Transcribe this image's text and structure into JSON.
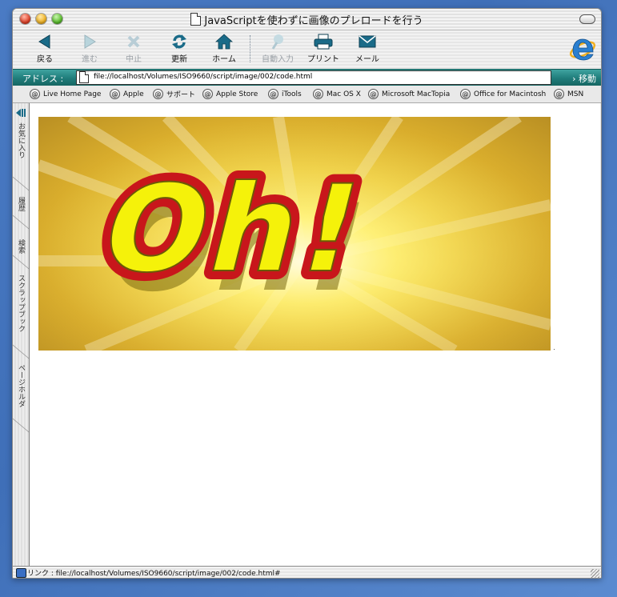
{
  "window": {
    "title": "JavaScriptを使わずに画像のプレロードを行う"
  },
  "toolbar": {
    "back_label": "戻る",
    "forward_label": "進む",
    "stop_label": "中止",
    "refresh_label": "更新",
    "home_label": "ホーム",
    "autofill_label": "自動入力",
    "print_label": "プリント",
    "mail_label": "メール"
  },
  "address": {
    "label": "アドレス :",
    "url": "file://localhost/Volumes/ISO9660/script/image/002/code.html",
    "go_label": "› 移動"
  },
  "favorites": [
    {
      "label": "Live Home Page"
    },
    {
      "label": "Apple"
    },
    {
      "label": "サポート"
    },
    {
      "label": "Apple Store"
    },
    {
      "label": "iTools"
    },
    {
      "label": "Mac OS X"
    },
    {
      "label": "Microsoft MacTopia"
    },
    {
      "label": "Office for Macintosh"
    },
    {
      "label": "MSN"
    }
  ],
  "sidebar": {
    "tabs": [
      {
        "label": "お気に入り"
      },
      {
        "label": "履歴"
      },
      {
        "label": "検索"
      },
      {
        "label": "スクラップブック"
      },
      {
        "label": "ページホルダ"
      }
    ]
  },
  "content": {
    "banner_text": "Oh!"
  },
  "status": {
    "text": "リンク : file://localhost/Volumes/ISO9660/script/image/002/code.html#"
  },
  "colors": {
    "accent_teal": "#1f7c7a",
    "banner_red": "#c8161b",
    "banner_yellow": "#f5f20a",
    "toolbar_icon": "#1a6b88"
  }
}
